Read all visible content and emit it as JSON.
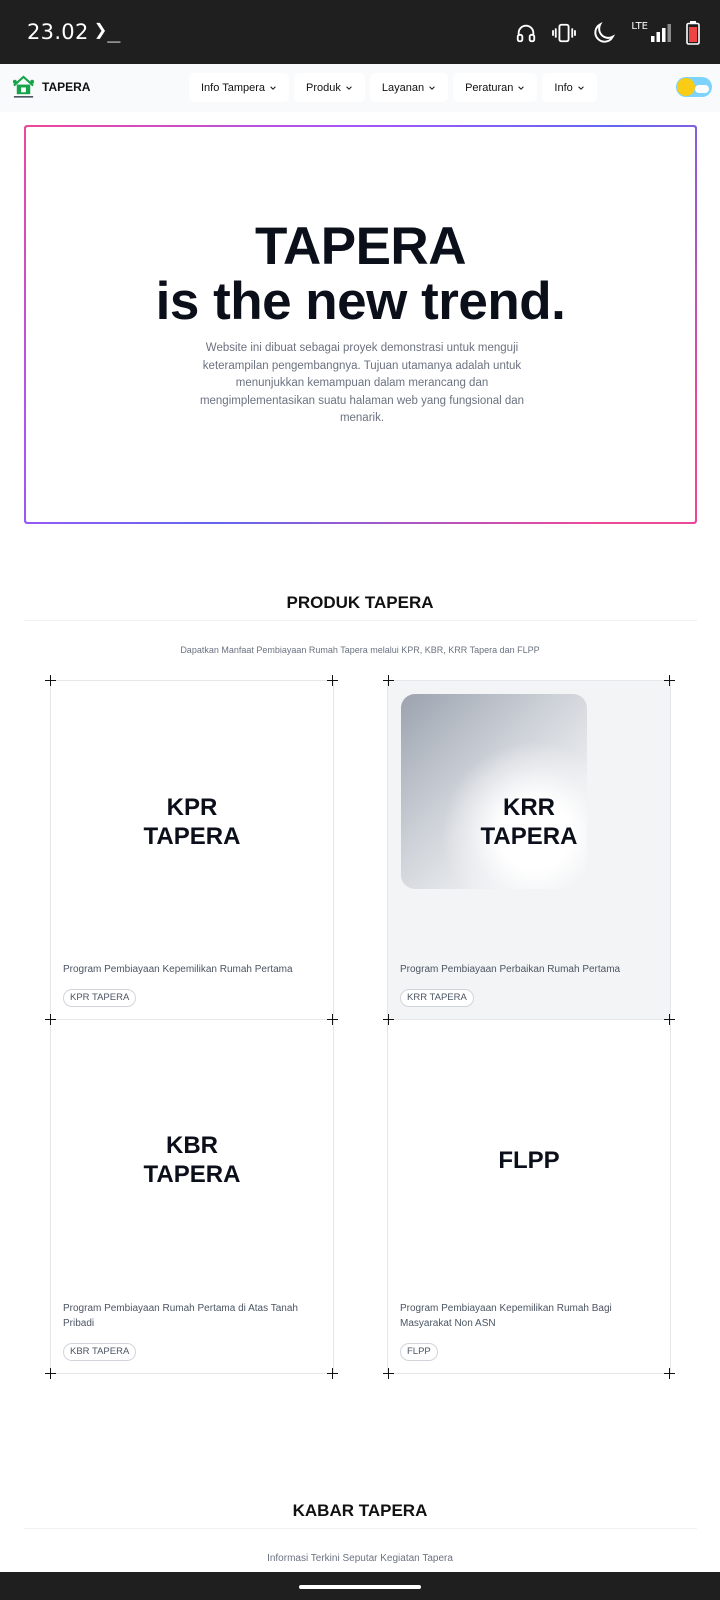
{
  "status_bar": {
    "time": "23.02",
    "prompt_glyph": "❯_",
    "network_label": "LTE",
    "icons": [
      "headphones-icon",
      "vibrate-icon",
      "moon-icon",
      "signal-icon",
      "battery-icon"
    ]
  },
  "navbar": {
    "brand": "TAPERA",
    "menu": [
      {
        "label": "Info Tampera"
      },
      {
        "label": "Produk"
      },
      {
        "label": "Layanan"
      },
      {
        "label": "Peraturan"
      },
      {
        "label": "Info"
      }
    ],
    "theme_toggle_state": "light"
  },
  "hero": {
    "title_line1": "TAPERA",
    "title_line2": "is the new trend.",
    "description": "Website ini dibuat sebagai proyek demonstrasi untuk menguji keterampilan pengembangnya. Tujuan utamanya adalah untuk menunjukkan kemampuan dalam merancang dan mengimplementasikan suatu halaman web yang fungsional dan menarik."
  },
  "produk": {
    "title": "PRODUK TAPERA",
    "subtitle": "Dapatkan Manfaat Pembiayaan Rumah Tapera melalui KPR, KBR, KRR Tapera dan FLPP",
    "cards": [
      {
        "heading": "KPR\nTAPERA",
        "description": "Program Pembiayaan Kepemilikan Rumah Pertama",
        "tag": "KPR TAPERA"
      },
      {
        "heading": "KRR\nTAPERA",
        "description": "Program Pembiayaan Perbaikan Rumah Pertama",
        "tag": "KRR TAPERA"
      },
      {
        "heading": "KBR\nTAPERA",
        "description": "Program Pembiayaan Rumah Pertama di Atas Tanah Pribadi",
        "tag": "KBR TAPERA"
      },
      {
        "heading": "FLPP",
        "description": "Program Pembiayaan Kepemilikan Rumah Bagi Masyarakat Non ASN",
        "tag": "FLPP"
      }
    ]
  },
  "kabar": {
    "title": "KABAR TAPERA",
    "subtitle": "Informasi Terkini Seputar Kegiatan Tapera"
  },
  "colors": {
    "accent_pink": "#ec4899",
    "accent_purple": "#a855f7",
    "accent_indigo": "#6366f1",
    "logo_green": "#16a34a",
    "status_bar": "#1f1f1f"
  }
}
